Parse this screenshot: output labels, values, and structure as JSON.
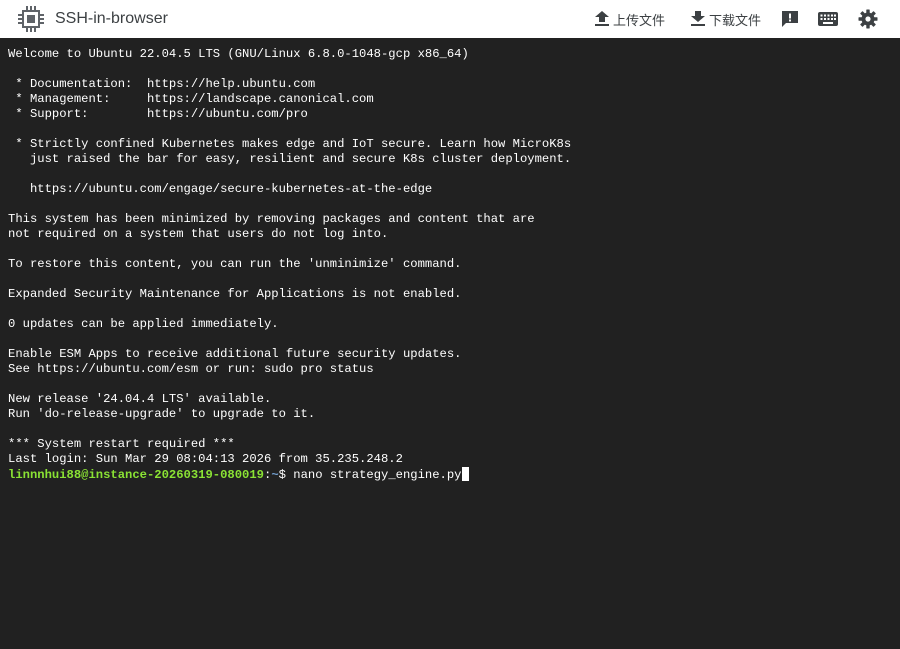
{
  "header": {
    "title": "SSH-in-browser",
    "logo_icon": "chip-icon",
    "upload_label": "上传文件",
    "upload_icon": "upload-icon",
    "download_label": "下载文件",
    "download_icon": "download-icon",
    "feedback_icon": "feedback-icon",
    "keyboard_icon": "keyboard-icon",
    "settings_icon": "gear-icon"
  },
  "terminal": {
    "lines": [
      "Welcome to Ubuntu 22.04.5 LTS (GNU/Linux 6.8.0-1048-gcp x86_64)",
      "",
      " * Documentation:  https://help.ubuntu.com",
      " * Management:     https://landscape.canonical.com",
      " * Support:        https://ubuntu.com/pro",
      "",
      " * Strictly confined Kubernetes makes edge and IoT secure. Learn how MicroK8s",
      "   just raised the bar for easy, resilient and secure K8s cluster deployment.",
      "",
      "   https://ubuntu.com/engage/secure-kubernetes-at-the-edge",
      "",
      "This system has been minimized by removing packages and content that are",
      "not required on a system that users do not log into.",
      "",
      "To restore this content, you can run the 'unminimize' command.",
      "",
      "Expanded Security Maintenance for Applications is not enabled.",
      "",
      "0 updates can be applied immediately.",
      "",
      "Enable ESM Apps to receive additional future security updates.",
      "See https://ubuntu.com/esm or run: sudo pro status",
      "",
      "New release '24.04.4 LTS' available.",
      "Run 'do-release-upgrade' to upgrade to it.",
      "",
      "*** System restart required ***",
      "Last login: Sun Mar 29 08:04:13 2026 from 35.235.248.2"
    ],
    "prompt": {
      "user_host": "linnnhui88@instance-20260319-080019",
      "separator": ":",
      "path": "~",
      "symbol": "$ ",
      "command": "nano strategy_engine.py"
    }
  },
  "colors": {
    "terminal_bg": "#212121",
    "terminal_fg": "#ffffff",
    "prompt_user": "#8ae234",
    "prompt_path": "#729fcf",
    "header_bg": "#ffffff"
  }
}
